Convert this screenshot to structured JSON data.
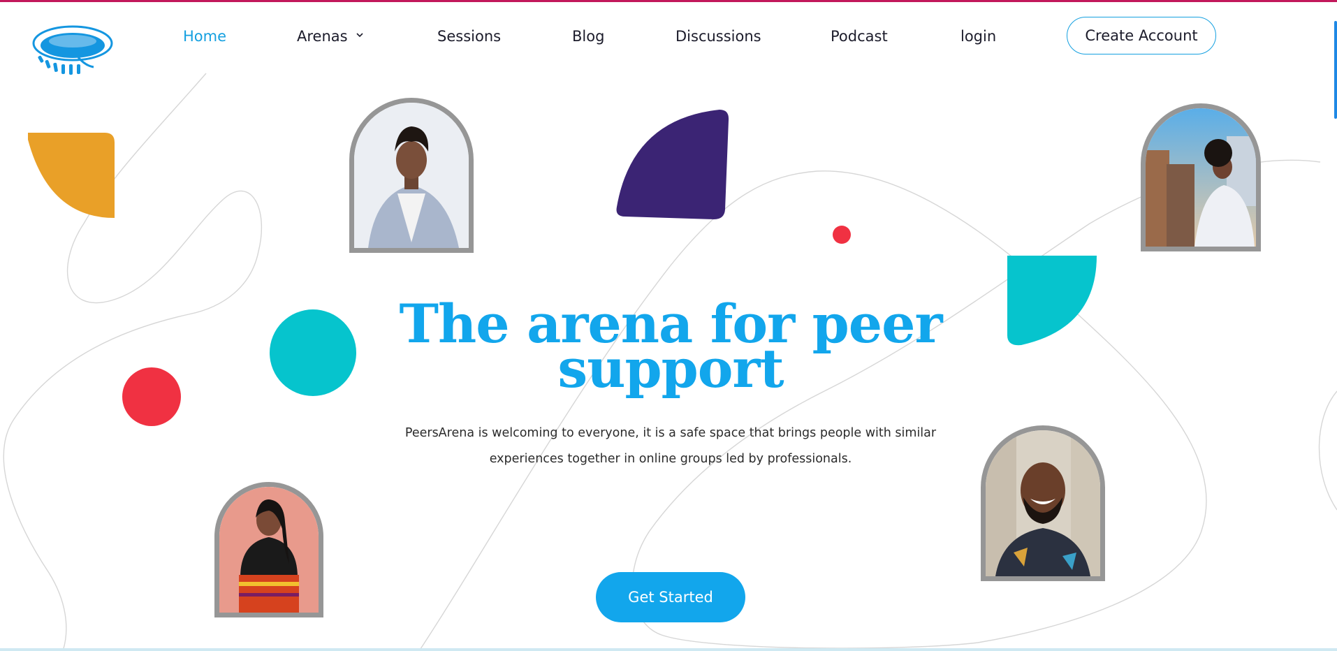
{
  "header": {
    "logo": "peersarena-stadium-logo",
    "nav": [
      {
        "label": "Home",
        "active": true
      },
      {
        "label": "Arenas",
        "has_dropdown": true
      },
      {
        "label": "Sessions"
      },
      {
        "label": "Blog"
      },
      {
        "label": "Discussions"
      },
      {
        "label": "Podcast"
      },
      {
        "label": "login"
      }
    ],
    "create_account_label": "Create Account"
  },
  "hero": {
    "title": "The arena for peer support",
    "description": "PeersArena is welcoming to everyone, it is a safe space that brings people with similar experiences together in online groups led by professionals.",
    "cta_label": "Get Started"
  },
  "colors": {
    "accent": "#12a6ec",
    "orange": "#e9a028",
    "purple": "#3b2474",
    "teal": "#06c4cd",
    "red": "#f03142",
    "frame": "#969696",
    "top_border": "#c2185b"
  },
  "portraits": [
    {
      "name": "young-man-grey-blazer"
    },
    {
      "name": "woman-balcony-city"
    },
    {
      "name": "woman-pink-background"
    },
    {
      "name": "smiling-bearded-man"
    }
  ]
}
